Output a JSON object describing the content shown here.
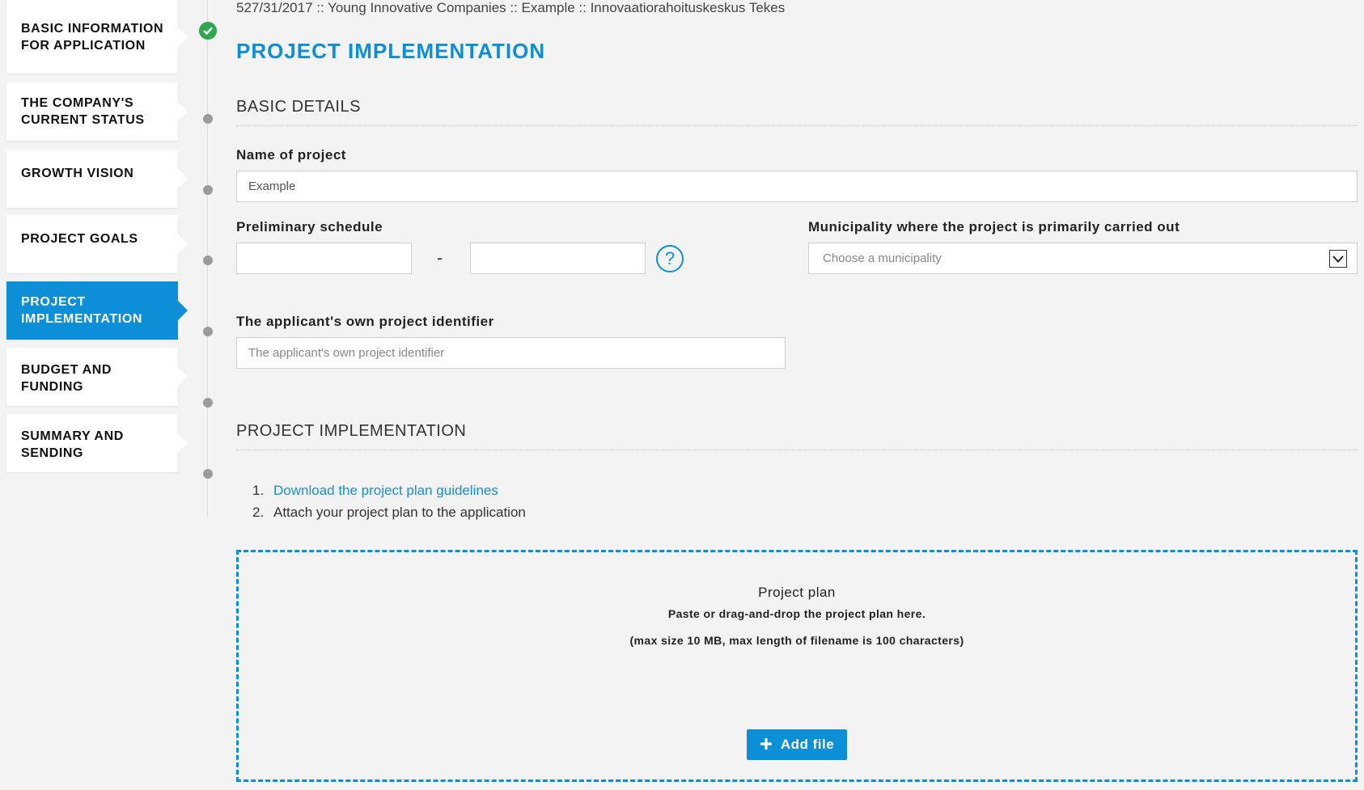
{
  "sidebar": {
    "steps": [
      {
        "label": "BASIC INFORMATION FOR APPLICATION",
        "status": "done"
      },
      {
        "label": "THE COMPANY'S CURRENT STATUS",
        "status": "pending"
      },
      {
        "label": "GROWTH VISION",
        "status": "pending"
      },
      {
        "label": "PROJECT GOALS",
        "status": "pending"
      },
      {
        "label": "PROJECT IMPLEMENTATION",
        "status": "active"
      },
      {
        "label": "BUDGET AND FUNDING",
        "status": "pending"
      },
      {
        "label": "SUMMARY AND SENDING",
        "status": "pending"
      }
    ]
  },
  "header": {
    "breadcrumb": "527/31/2017 :: Young Innovative Companies :: Example :: Innovaatiorahoituskeskus Tekes",
    "title": "PROJECT IMPLEMENTATION"
  },
  "basic_details": {
    "section_title": "BASIC DETAILS",
    "name_label": "Name of project",
    "name_value": "Example",
    "schedule_label": "Preliminary schedule",
    "schedule_start": "",
    "schedule_end": "",
    "schedule_separator": "-",
    "help_symbol": "?",
    "municipality_label": "Municipality where the project is primarily carried out",
    "municipality_placeholder": "Choose a municipality",
    "identifier_label": "The applicant's own project identifier",
    "identifier_placeholder": "The applicant's own project identifier"
  },
  "implementation": {
    "section_title": "PROJECT IMPLEMENTATION",
    "step1_number": "1.",
    "step1_link": "Download the project plan guidelines",
    "step2_number": "2.",
    "step2_text": "Attach your project plan to the application",
    "dropzone_title": "Project plan",
    "dropzone_text": "Paste or drag-and-drop the project plan here.",
    "dropzone_limits": "(max size 10 MB, max length of filename is 100 characters)",
    "add_button_label": "Add file"
  },
  "colors": {
    "accent": "#0d8fd8",
    "success": "#2ea84f",
    "background": "#f3f3f3"
  },
  "icons": {
    "completed_step": "check-icon",
    "help": "question-circle-icon",
    "select": "chevron-down-icon",
    "add": "plus-icon"
  }
}
